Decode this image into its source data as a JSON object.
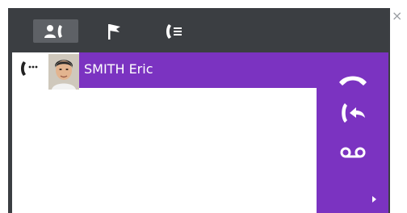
{
  "window": {
    "close_glyph": "×"
  },
  "tabs": [
    {
      "icon": "contacts-icon",
      "active": true
    },
    {
      "icon": "flag-icon",
      "active": false
    },
    {
      "icon": "call-log-icon",
      "active": false
    }
  ],
  "call": {
    "contact_name": "SMITH Eric",
    "status_icon": "call-ringing-icon"
  },
  "actions": [
    {
      "icon": "hang-up-icon"
    },
    {
      "icon": "transfer-call-icon"
    },
    {
      "icon": "voicemail-icon"
    },
    {
      "icon": "more-chevron-icon"
    }
  ],
  "colors": {
    "window_bg": "#3b3e42",
    "active_tab_bg": "#5e6166",
    "accent_purple": "#7b33c1",
    "icon_white": "#ffffff"
  }
}
